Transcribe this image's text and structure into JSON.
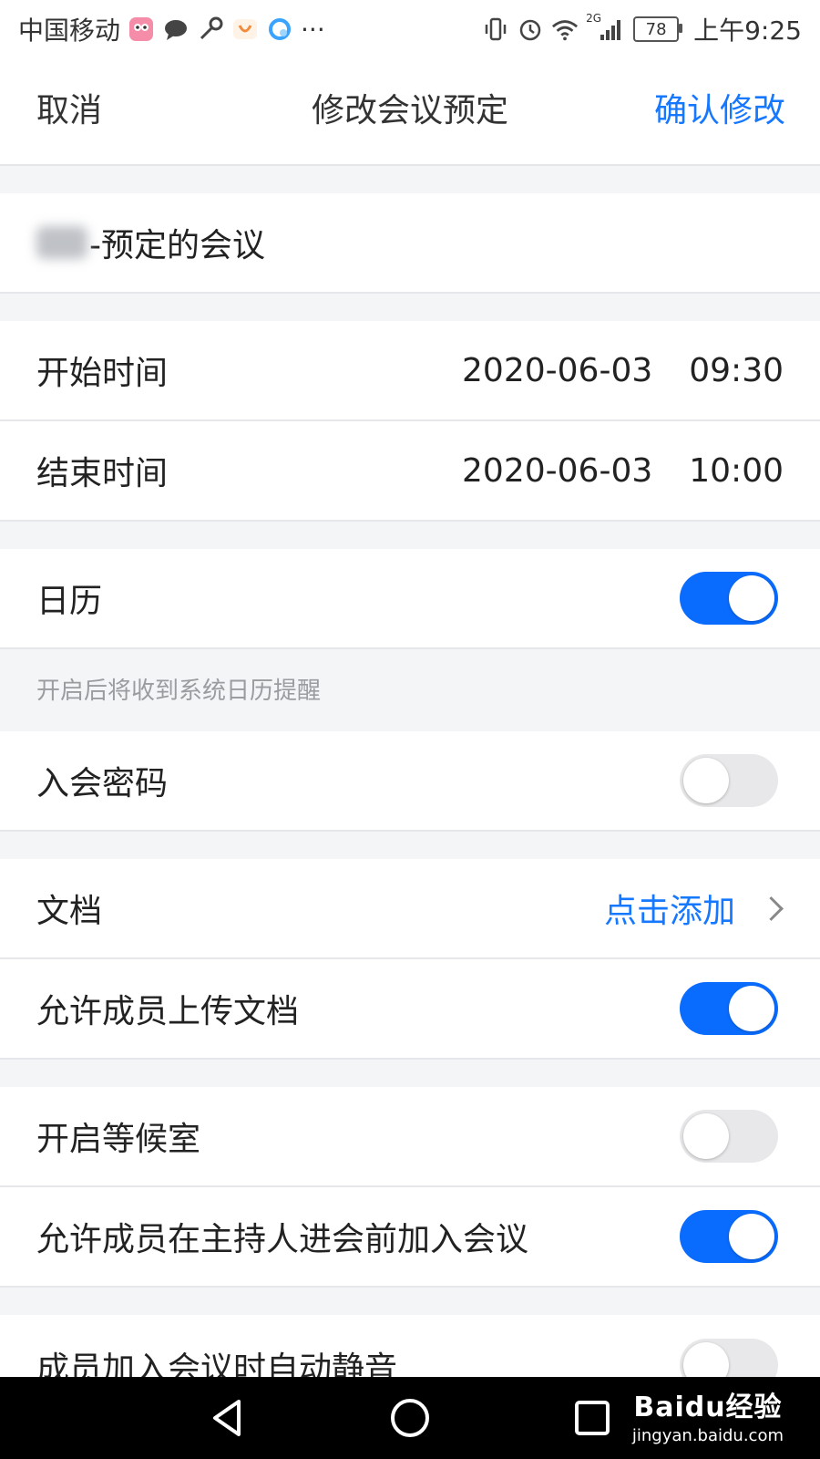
{
  "status_bar": {
    "carrier": "中国移动",
    "more": "···",
    "network": "2G",
    "battery": "78",
    "time": "上午9:25"
  },
  "nav": {
    "cancel": "取消",
    "title": "修改会议预定",
    "confirm": "确认修改"
  },
  "meeting": {
    "title_suffix": "-预定的会议"
  },
  "times": {
    "start_label": "开始时间",
    "start_date": "2020-06-03",
    "start_time": "09:30",
    "end_label": "结束时间",
    "end_date": "2020-06-03",
    "end_time": "10:00"
  },
  "settings": {
    "calendar_label": "日历",
    "calendar_on": true,
    "calendar_hint": "开启后将收到系统日历提醒",
    "password_label": "入会密码",
    "password_on": false,
    "docs_label": "文档",
    "docs_action": "点击添加",
    "allow_upload_label": "允许成员上传文档",
    "allow_upload_on": true,
    "waiting_room_label": "开启等候室",
    "waiting_room_on": false,
    "join_before_host_label": "允许成员在主持人进会前加入会议",
    "join_before_host_on": true,
    "auto_mute_label": "成员加入会议时自动静音",
    "auto_mute_on": false
  },
  "watermark": {
    "brand": "Baidu经验",
    "url": "jingyan.baidu.com"
  },
  "colors": {
    "accent": "#1677ff",
    "toggle_on": "#0a6cff",
    "toggle_off": "#e8e8ea"
  }
}
